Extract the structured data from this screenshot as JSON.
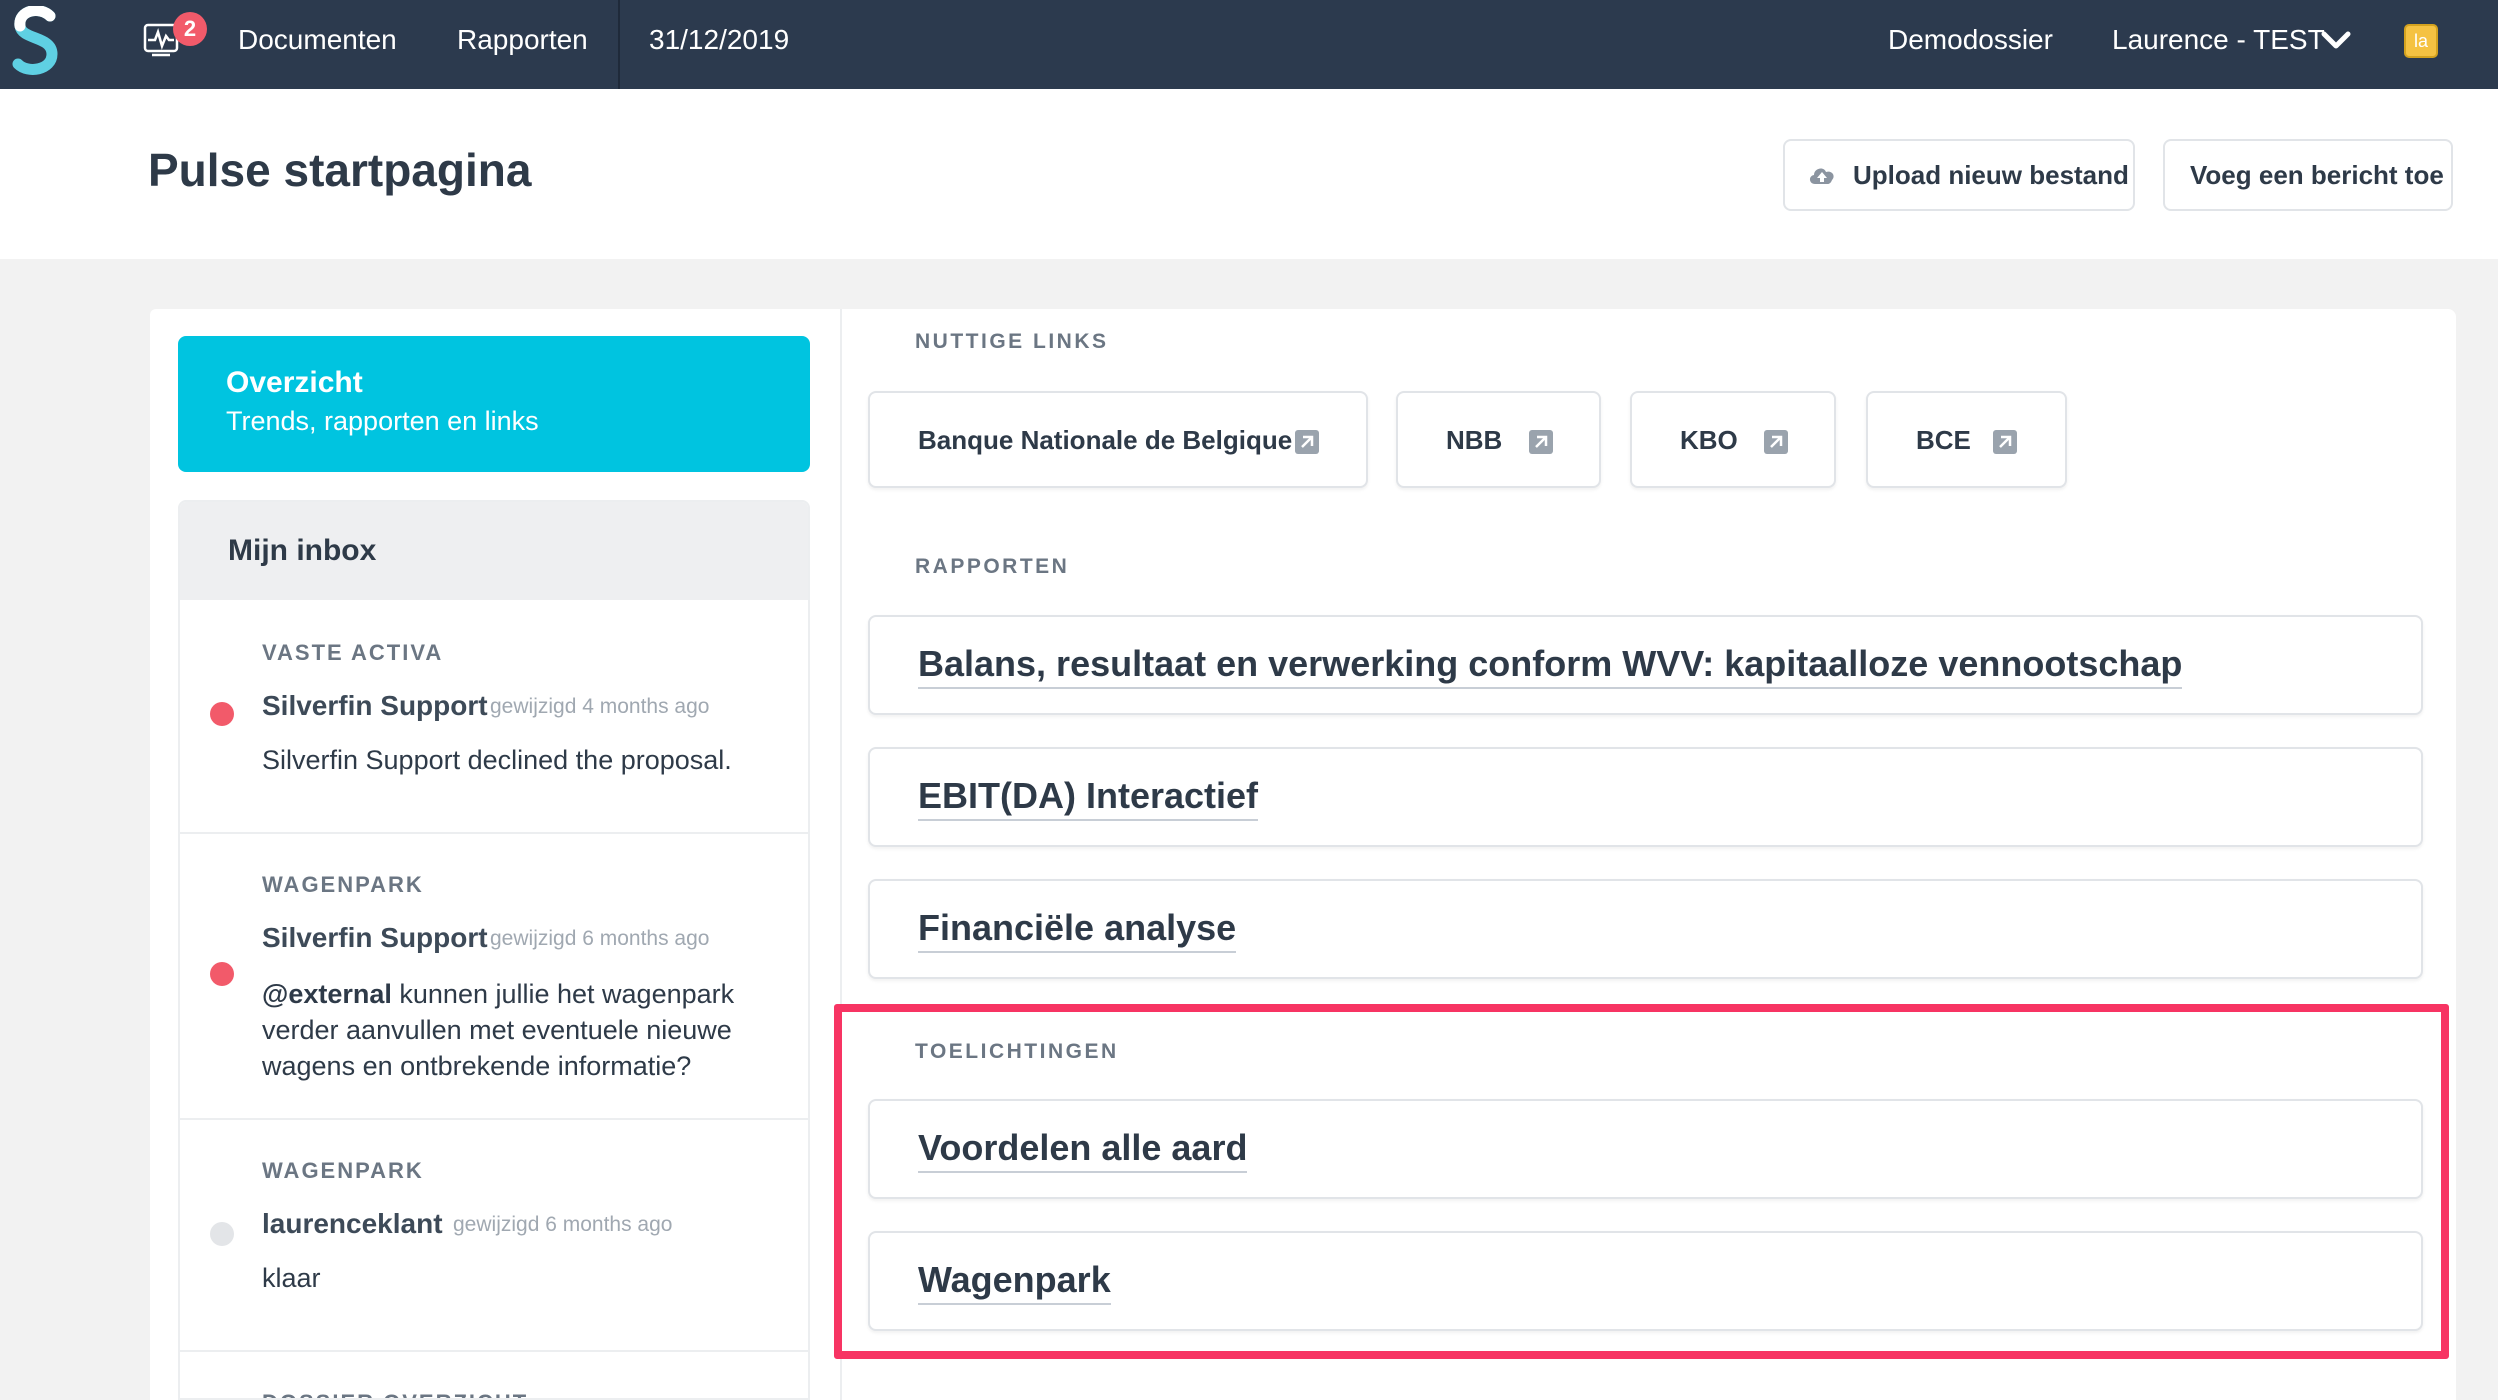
{
  "nav": {
    "pulse_badge": "2",
    "documents": "Documenten",
    "reports": "Rapporten",
    "date": "31/12/2019",
    "dossier": "Demodossier",
    "user": "Laurence - TEST",
    "avatar_initials": "la"
  },
  "header": {
    "title": "Pulse startpagina",
    "upload_label": "Upload nieuw bestand",
    "post_label": "Voeg een bericht toe"
  },
  "overview": {
    "title": "Overzicht",
    "subtitle": "Trends, rapporten en links"
  },
  "inbox": {
    "title": "Mijn inbox",
    "messages": [
      {
        "category": "VASTE ACTIVA",
        "author": "Silverfin Support",
        "modified": "gewijzigd 4 months ago",
        "text": "Silverfin Support declined the proposal.",
        "unread": true
      },
      {
        "category": "WAGENPARK",
        "author": "Silverfin Support",
        "modified": "gewijzigd 6 months ago",
        "mention": "@external",
        "text": " kunnen jullie het wagenpark verder aanvullen met eventuele nieuwe wagens en ontbrekende informatie?",
        "unread": true
      },
      {
        "category": "WAGENPARK",
        "author": "laurenceklant",
        "modified": "gewijzigd 6 months ago",
        "text": "klaar",
        "unread": false
      },
      {
        "category": "DOSSIER OVERZICHT"
      }
    ]
  },
  "links": {
    "heading": "NUTTIGE LINKS",
    "items": [
      "Banque Nationale de Belgique",
      "NBB",
      "KBO",
      "BCE"
    ]
  },
  "reports": {
    "heading": "RAPPORTEN",
    "items": [
      "Balans, resultaat en verwerking conform WVV: kapitaalloze vennootschap",
      "EBIT(DA) Interactief",
      "Financiële analyse"
    ]
  },
  "notes": {
    "heading": "TOELICHTINGEN",
    "items": [
      "Voordelen alle aard",
      "Wagenpark"
    ]
  },
  "colors": {
    "nav_bg": "#2c3a4e",
    "accent": "#00c4e0",
    "unread_dot": "#f25a6a",
    "read_dot": "#e3e5e8",
    "highlight": "#f73463"
  }
}
